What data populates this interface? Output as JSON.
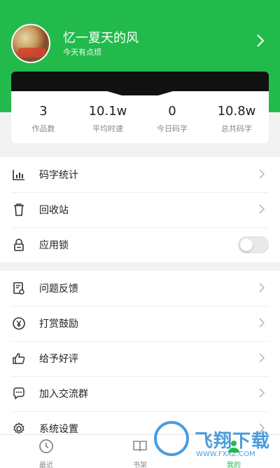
{
  "profile": {
    "name": "忆一夏天的风",
    "subtitle": "今天有点烦"
  },
  "stats": [
    {
      "value": "3",
      "label": "作品数"
    },
    {
      "value": "10.1w",
      "label": "平均时速"
    },
    {
      "value": "0",
      "label": "今日码字"
    },
    {
      "value": "10.8w",
      "label": "总共码字"
    }
  ],
  "menu_group1": [
    {
      "label": "码字统计",
      "icon": "bar-chart-icon"
    },
    {
      "label": "回收站",
      "icon": "trash-icon"
    },
    {
      "label": "应用锁",
      "icon": "lock-icon"
    }
  ],
  "app_lock_enabled": false,
  "menu_group2": [
    {
      "label": "问题反馈",
      "icon": "feedback-icon"
    },
    {
      "label": "打赏鼓励",
      "icon": "yen-coin-icon"
    },
    {
      "label": "给予好评",
      "icon": "thumbs-up-icon"
    },
    {
      "label": "加入交流群",
      "icon": "chat-icon"
    },
    {
      "label": "系统设置",
      "icon": "gear-icon"
    }
  ],
  "tabbar": [
    {
      "label": "最近",
      "icon": "clock-icon",
      "active": false
    },
    {
      "label": "书架",
      "icon": "book-icon",
      "active": false
    },
    {
      "label": "我的",
      "icon": "user-icon",
      "active": true
    }
  ],
  "watermark": {
    "text": "飞翔下载",
    "url": "WWW.FXXZ.COM"
  },
  "colors": {
    "accent": "#22bb4b",
    "background": "#f2f2f2"
  }
}
